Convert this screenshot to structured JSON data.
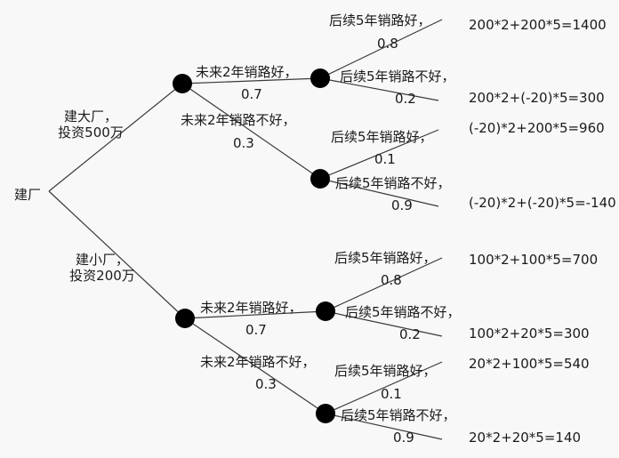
{
  "root": {
    "label": "建厂"
  },
  "big": {
    "label_line1": "建大厂，",
    "label_line2": "投资500万",
    "good2": {
      "label": "未来2年销路好，",
      "prob": "0.7"
    },
    "bad2": {
      "label": "未来2年销路不好，",
      "prob": "0.3"
    },
    "g_good": {
      "label": "后续5年销路好，",
      "prob": "0.8",
      "result": "200*2+200*5=1400"
    },
    "g_bad": {
      "label": "后续5年销路不好，",
      "prob": "0.2",
      "result": "200*2+(-20)*5=300"
    },
    "b_good": {
      "label": "后续5年销路好，",
      "prob": "0.1",
      "result": "(-20)*2+200*5=960"
    },
    "b_bad": {
      "label": "后续5年销路不好，",
      "prob": "0.9",
      "result": "(-20)*2+(-20)*5=-140"
    }
  },
  "small": {
    "label_line1": "建小厂，",
    "label_line2": "投资200万",
    "good2": {
      "label": "未来2年销路好，",
      "prob": "0.7"
    },
    "bad2": {
      "label": "未来2年销路不好，",
      "prob": "0.3"
    },
    "g_good": {
      "label": "后续5年销路好，",
      "prob": "0.8",
      "result": "100*2+100*5=700"
    },
    "g_bad": {
      "label": "后续5年销路不好，",
      "prob": "0.2",
      "result": "100*2+20*5=300"
    },
    "b_good": {
      "label": "后续5年销路好，",
      "prob": "0.1",
      "result": "20*2+100*5=540"
    },
    "b_bad": {
      "label": "后续5年销路不好，",
      "prob": "0.9",
      "result": "20*2+20*5=140"
    }
  },
  "colors": {
    "line": "#3a3a3a",
    "node": "#000000",
    "text": "#1a1a1a",
    "background": "#f8f8f8"
  }
}
